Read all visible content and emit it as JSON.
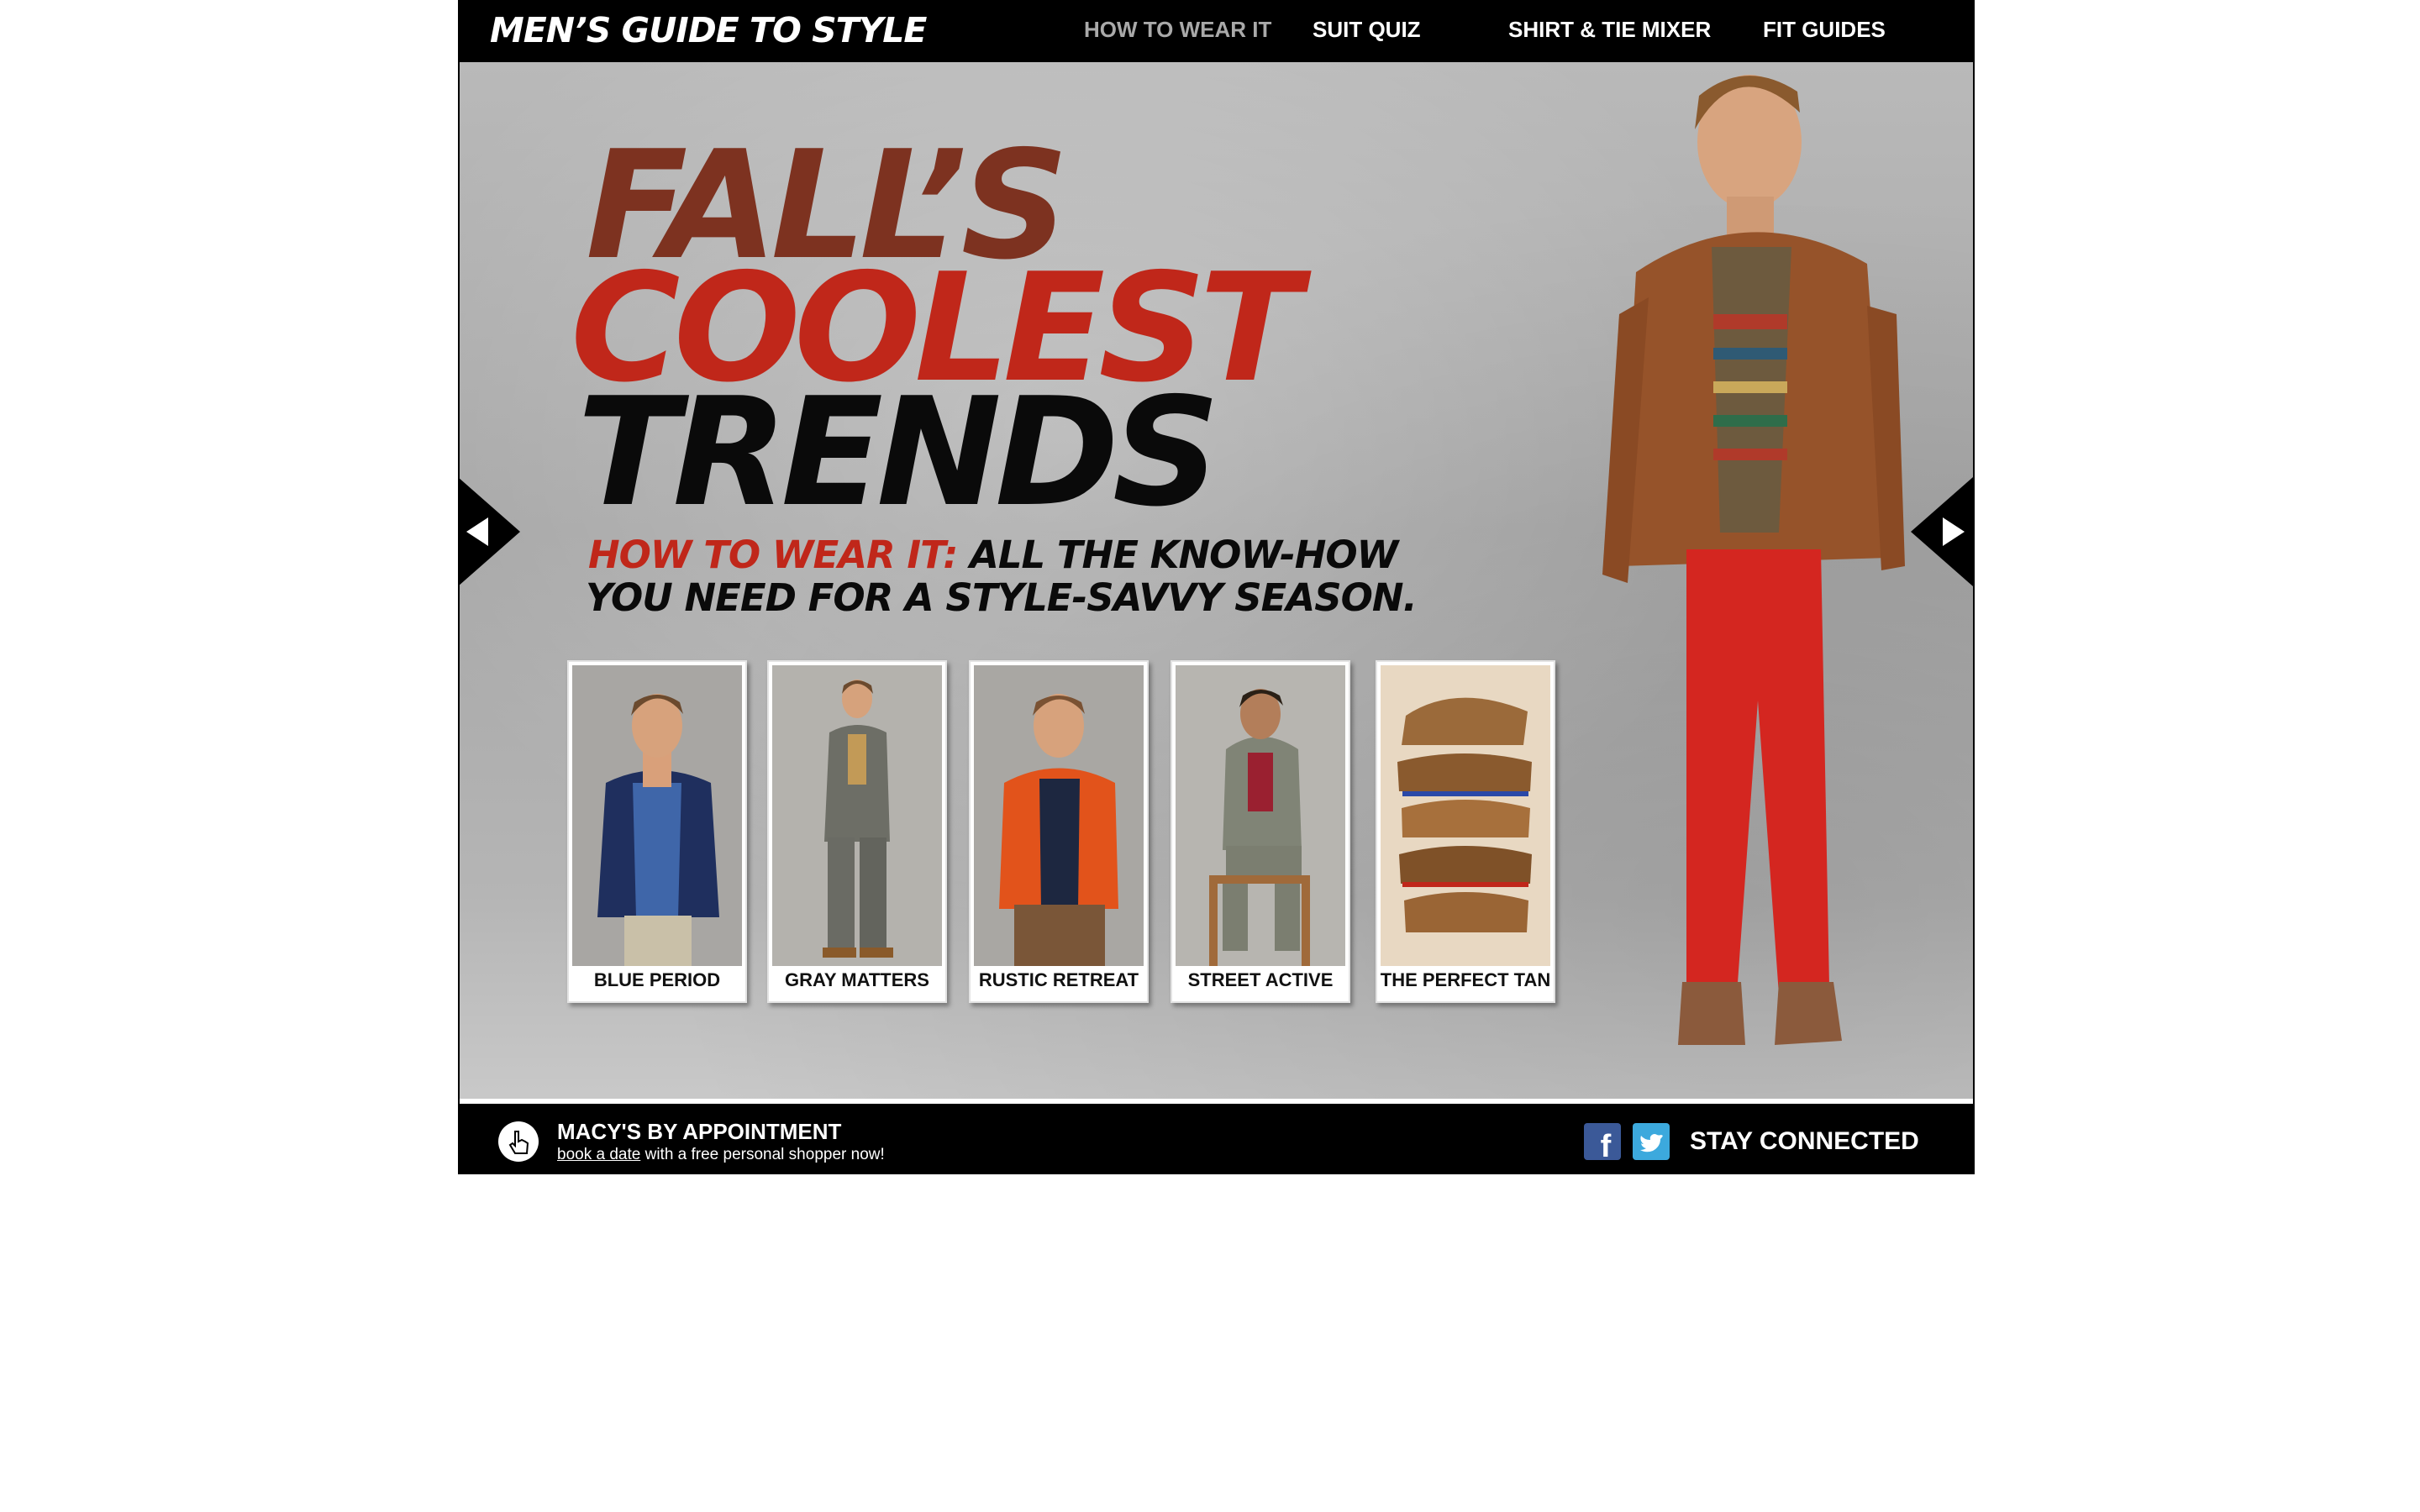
{
  "header": {
    "brand": "MEN’S GUIDE TO STYLE",
    "nav": [
      {
        "label": "HOW TO WEAR IT",
        "active": true
      },
      {
        "label": "SUIT QUIZ",
        "active": false
      },
      {
        "label": "SHIRT & TIE MIXER",
        "active": false
      },
      {
        "label": "FIT GUIDES",
        "active": false
      }
    ]
  },
  "hero": {
    "headline": [
      "FALL’S",
      "COOLEST",
      "TRENDS"
    ],
    "subhead_red": "HOW TO WEAR IT:",
    "subhead_line1": " ALL THE KNOW-HOW",
    "subhead_line2": "YOU NEED FOR A STYLE-SAVVY SEASON.",
    "colors": {
      "rust": "#7d3220",
      "red": "#c0271a",
      "black": "#0a0a0a"
    },
    "trends": [
      {
        "label": "BLUE PERIOD"
      },
      {
        "label": "GRAY MATTERS"
      },
      {
        "label": "RUSTIC RETREAT"
      },
      {
        "label": "STREET ACTIVE"
      },
      {
        "label": "THE PERFECT TAN"
      }
    ]
  },
  "footer": {
    "appointment_title": "MACY'S BY APPOINTMENT",
    "appointment_link": "book a date",
    "appointment_rest": " with a free personal shopper now!",
    "stay_connected": "STAY CONNECTED"
  }
}
